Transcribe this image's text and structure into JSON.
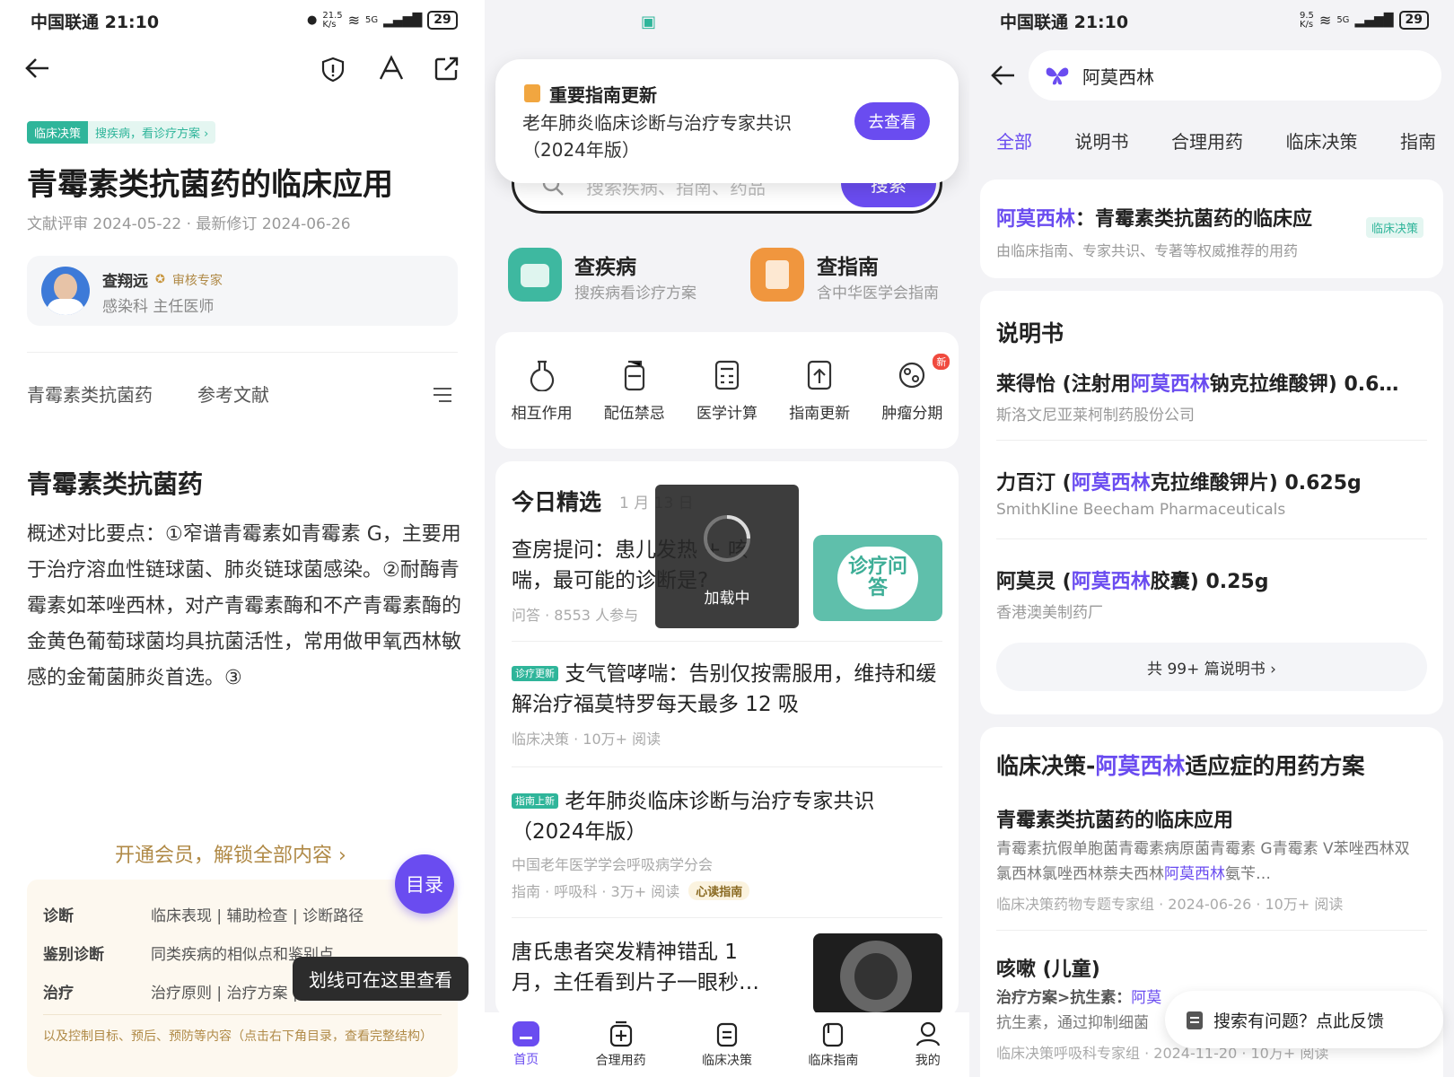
{
  "colors": {
    "accent": "#6a4cf0",
    "green": "#2fb59a",
    "gold": "#b08a47"
  },
  "p1": {
    "carrier_time": "中国联通 21:10",
    "net_speed": "21.5\nK/s",
    "net_5g": "5G",
    "battery": "29",
    "tag_main": "临床决策",
    "tag_sub": "搜疾病，看诊疗方案 ›",
    "title": "青霉素类抗菌药的临床应用",
    "dates": "文献评审 2024-05-22 · 最新修订 2024-06-26",
    "author_name": "查翔远",
    "author_badge": "审核专家",
    "author_role": "感染科 主任医师",
    "tab1": "青霉素类抗菌药",
    "tab2": "参考文献",
    "section_title": "青霉素类抗菌药",
    "body": "概述对比要点：①窄谱青霉素如青霉素 G，主要用于治疗溶血性链球菌、肺炎链球菌感染。②耐酶青霉素如苯唑西林，对产青霉素酶和不产青霉素酶的金黄色葡萄球菌均具抗菌活性，常用做甲氧西林敏感的金葡菌肺炎首选。③",
    "unlock": "开通会员，解锁全部内容 ›",
    "toc_button": "目录",
    "toc": [
      {
        "k": "诊断",
        "v": "临床表现 | 辅助检查 | 诊断路径"
      },
      {
        "k": "鉴别诊断",
        "v": "同类疾病的相似点和鉴别点"
      },
      {
        "k": "治疗",
        "v": "治疗原则 | 治疗方案 | 药物治疗"
      }
    ],
    "tooltip": "划线可在这里查看",
    "footer_note": "以及控制目标、预后、预防等内容（点击右下角目录，查看完整结构）"
  },
  "p2": {
    "notice_title": "重要指南更新",
    "notice_body": "老年肺炎临床诊断与治疗专家共识（2024年版）",
    "notice_btn": "去查看",
    "search_placeholder": "搜索疾病、指南、药品",
    "search_btn": "搜索",
    "feat1_title": "查疾病",
    "feat1_sub": "搜疾病看诊疗方案",
    "feat2_title": "查指南",
    "feat2_sub": "含中华医学会指南",
    "tools": [
      "相互作用",
      "配伍禁忌",
      "医学计算",
      "指南更新",
      "肿瘤分期"
    ],
    "tool_new": "新",
    "today_title": "今日精选",
    "today_date": "1 月 13 日",
    "q_title": "查房提问：患儿发热 + 咳喘，最可能的诊断是?",
    "q_meta": "问答 · 8553 人参与",
    "q_img_text": "诊疗问答",
    "loading": "加载中",
    "a2_chip": "诊疗更新",
    "a2_title": "支气管哮喘：告别仅按需服用，维持和缓解治疗福莫特罗每天最多 12 吸",
    "a2_meta": "临床决策 · 10万+ 阅读",
    "a3_chip": "指南上新",
    "a3_title": "老年肺炎临床诊断与治疗专家共识（2024年版）",
    "a3_org": "中国老年医学学会呼吸病学分会",
    "a3_meta": "指南 · 呼吸科 · 3万+ 阅读",
    "a3_badge": "心读指南",
    "a4_title": "唐氏患者突发精神错乱 1 月，主任看到片子一眼秒…",
    "nav": [
      "首页",
      "合理用药",
      "临床决策",
      "临床指南",
      "我的"
    ]
  },
  "p3": {
    "carrier_time": "中国联通 21:10",
    "net_speed": "9.5\nK/s",
    "net_5g": "5G",
    "battery": "29",
    "query": "阿莫西林",
    "tabs": [
      "全部",
      "说明书",
      "合理用药",
      "临床决策",
      "指南"
    ],
    "top_hl": "阿莫西林",
    "top_rest": "：青霉素类抗菌药的临床应",
    "top_tag": "临床决策",
    "top_sub": "由临床指南、专家共识、专著等权威推荐的用药",
    "sms_title": "说明书",
    "items": [
      {
        "pre": "莱得怡 (注射用",
        "hl": "阿莫西林",
        "post": "钠克拉维酸钾) 0.6…",
        "co": "斯洛文尼亚莱柯制药股份公司"
      },
      {
        "pre": "力百汀 (",
        "hl": "阿莫西林",
        "post": "克拉维酸钾片) 0.625g",
        "co": "SmithKline Beecham Pharmaceuticals"
      },
      {
        "pre": "阿莫灵 (",
        "hl": "阿莫西林",
        "post": "胶囊) 0.25g",
        "co": "香港澳美制药厂"
      }
    ],
    "more": "共 99+ 篇说明书 ›",
    "cd_pre": "临床决策-",
    "cd_hl": "阿莫西林",
    "cd_post": "适应症的用药方案",
    "cd1_title": "青霉素类抗菌药的临床应用",
    "cd1_body_a": "青霉素抗假单胞菌青霉素病原菌青霉素 G青霉素 V苯唑西林双氯西林氯唑西林萘夫西林",
    "cd1_body_hl": "阿莫西林",
    "cd1_body_b": "氨苄…",
    "cd1_meta": "临床决策药物专题专家组 · 2024-06-26 · 10万+ 阅读",
    "cd2_title": "咳嗽 (儿童)",
    "cd2_body_a": "治疗方案>抗生素：",
    "cd2_body_hl": "阿莫",
    "cd2_body_b": "抗生素，通过抑制细菌",
    "cd2_meta": "临床决策呼吸科专家组 · 2024-11-20 · 10万+ 阅读",
    "feedback": "搜索有问题？点此反馈"
  }
}
